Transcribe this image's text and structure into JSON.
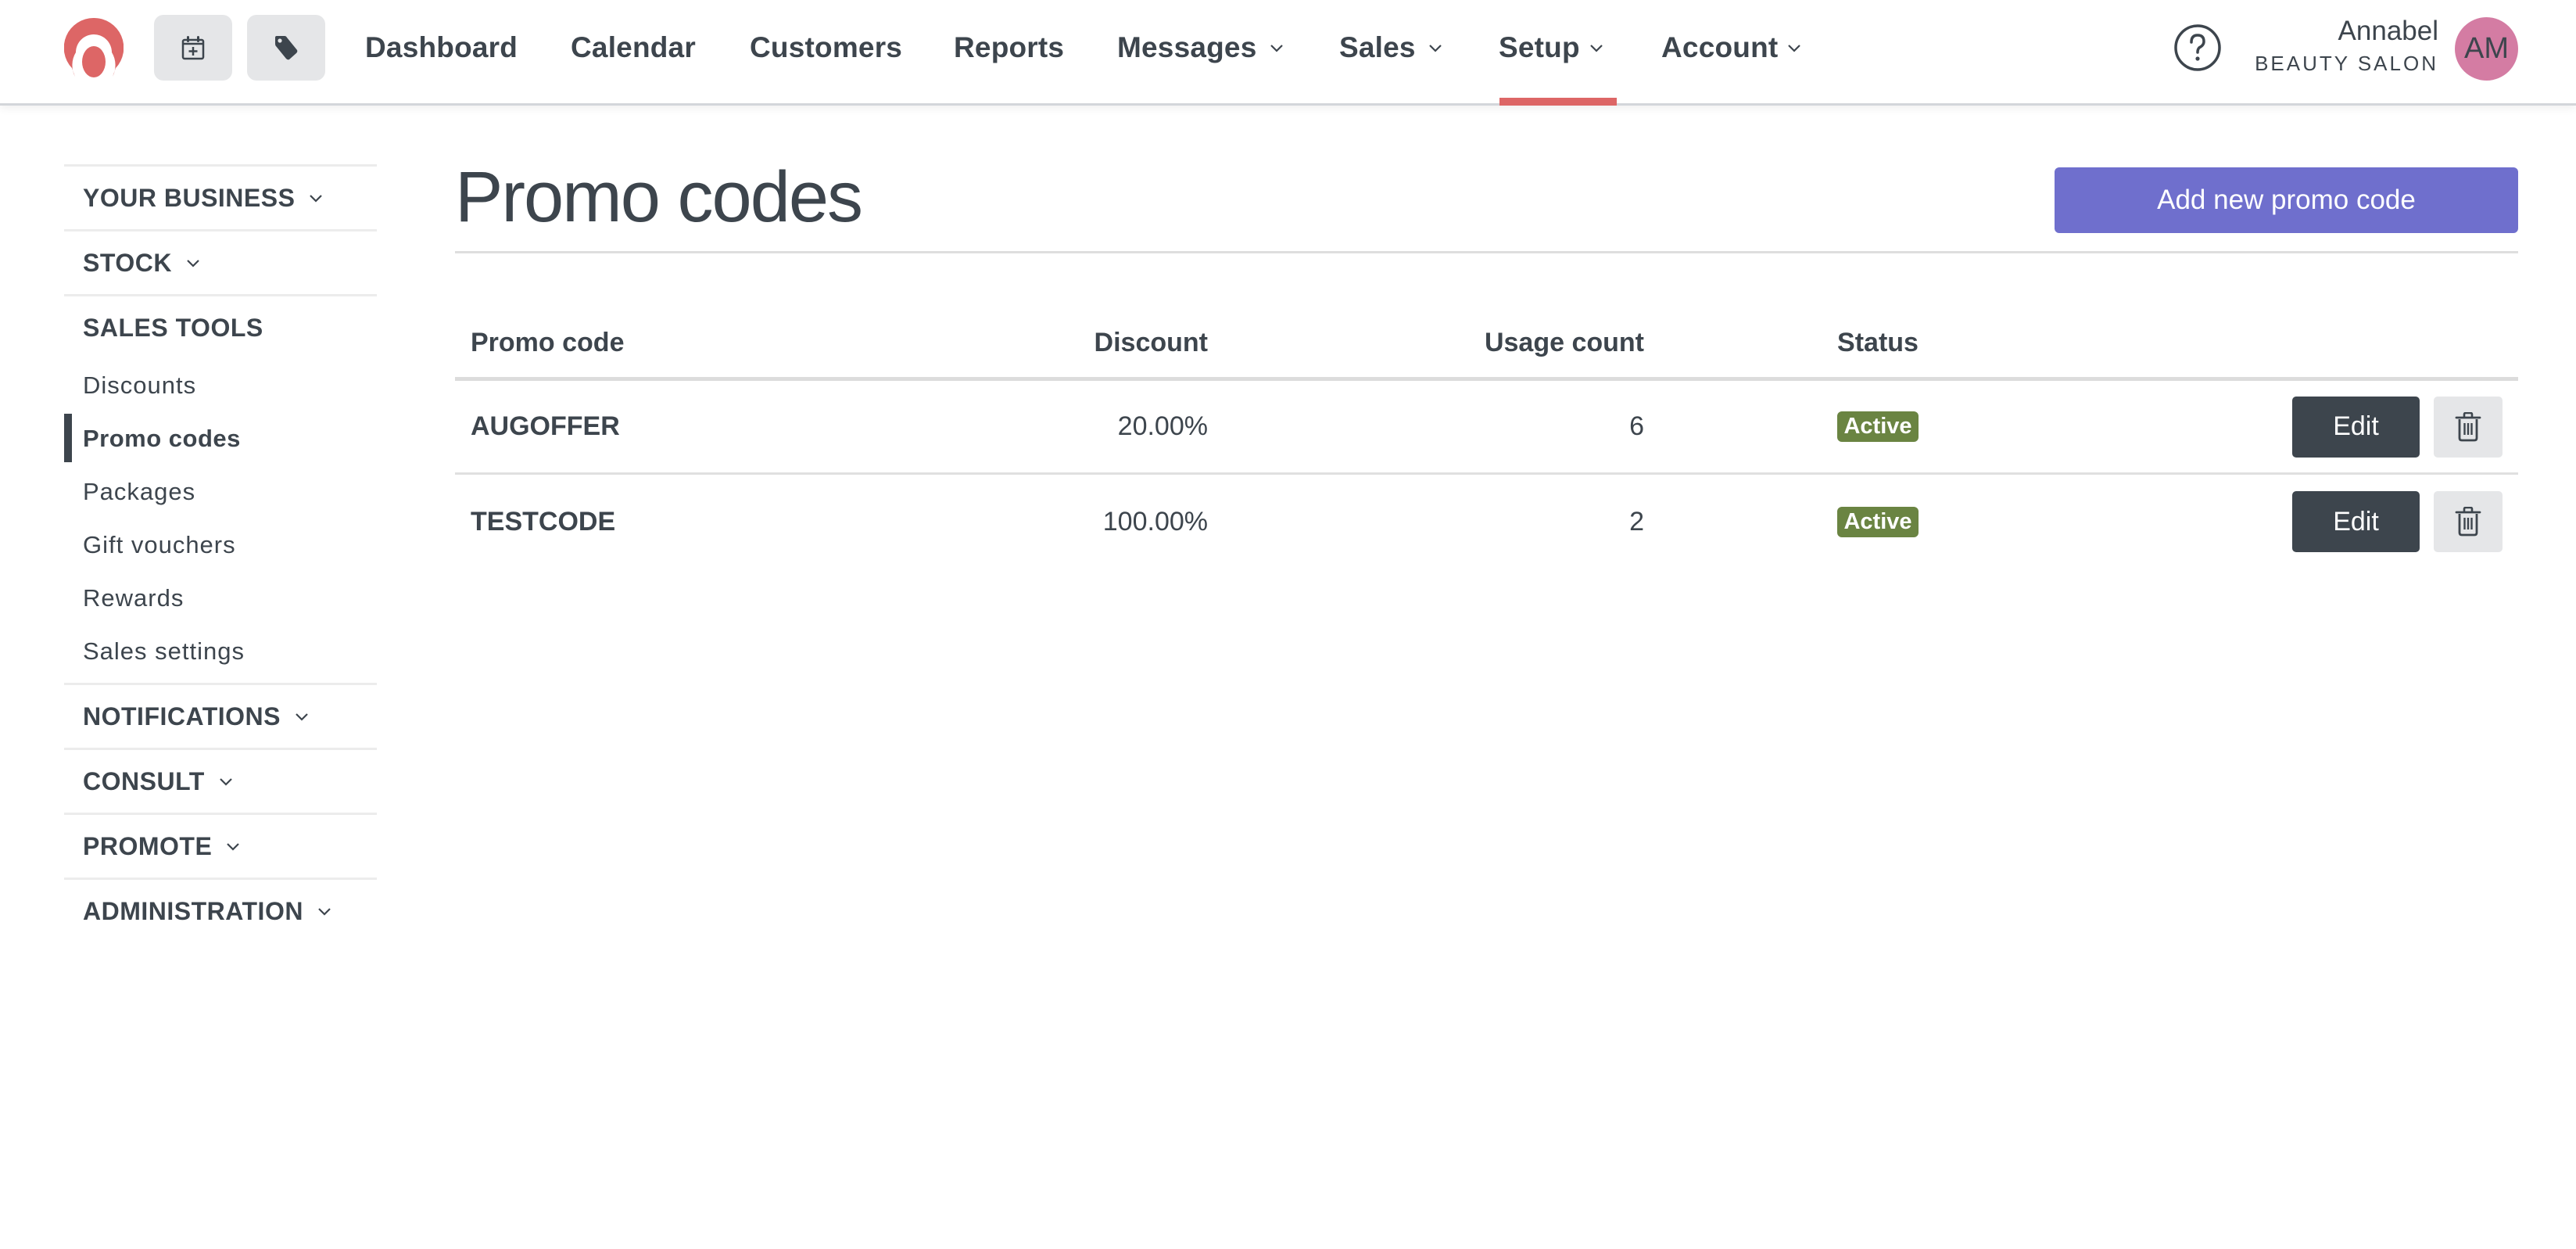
{
  "header": {
    "logo_name": "brand-logo",
    "quick_actions": [
      {
        "icon": "calendar-plus-icon",
        "label": "New appointment"
      },
      {
        "icon": "tag-icon",
        "label": "New sale"
      }
    ],
    "nav": [
      {
        "label": "Dashboard",
        "dropdown": false
      },
      {
        "label": "Calendar",
        "dropdown": false
      },
      {
        "label": "Customers",
        "dropdown": false
      },
      {
        "label": "Reports",
        "dropdown": false
      },
      {
        "label": "Messages",
        "dropdown": true
      },
      {
        "label": "Sales",
        "dropdown": true
      },
      {
        "label": "Setup",
        "dropdown": true,
        "active": true
      },
      {
        "label": "Account",
        "dropdown": true
      }
    ],
    "help_icon": "question-circle-icon",
    "user": {
      "name": "Annabel",
      "business": "BEAUTY SALON",
      "initials": "AM"
    }
  },
  "sidebar": {
    "sections": [
      {
        "label": "YOUR BUSINESS",
        "collapsible": true,
        "expanded": false
      },
      {
        "label": "STOCK",
        "collapsible": true,
        "expanded": false
      },
      {
        "label": "SALES TOOLS",
        "collapsible": false,
        "expanded": true,
        "items": [
          {
            "label": "Discounts",
            "active": false
          },
          {
            "label": "Promo codes",
            "active": true
          },
          {
            "label": "Packages",
            "active": false
          },
          {
            "label": "Gift vouchers",
            "active": false
          },
          {
            "label": "Rewards",
            "active": false
          },
          {
            "label": "Sales settings",
            "active": false
          }
        ]
      },
      {
        "label": "NOTIFICATIONS",
        "collapsible": true,
        "expanded": false
      },
      {
        "label": "CONSULT",
        "collapsible": true,
        "expanded": false
      },
      {
        "label": "PROMOTE",
        "collapsible": true,
        "expanded": false
      },
      {
        "label": "ADMINISTRATION",
        "collapsible": true,
        "expanded": false
      }
    ]
  },
  "main": {
    "title": "Promo codes",
    "add_button_label": "Add new promo code",
    "table": {
      "columns": [
        "Promo code",
        "Discount",
        "Usage count",
        "Status",
        ""
      ],
      "rows": [
        {
          "code": "AUGOFFER",
          "discount": "20.00%",
          "usage_count": "6",
          "status": "Active",
          "edit_label": "Edit"
        },
        {
          "code": "TESTCODE",
          "discount": "100.00%",
          "usage_count": "2",
          "status": "Active",
          "edit_label": "Edit"
        }
      ]
    }
  },
  "colors": {
    "brand": "#dd6666",
    "primary_button": "#6f6fcd",
    "text": "#3d454d",
    "status_active": "#6a8442",
    "avatar": "#d47ca3",
    "quick_button_bg": "#e5e6e8"
  }
}
